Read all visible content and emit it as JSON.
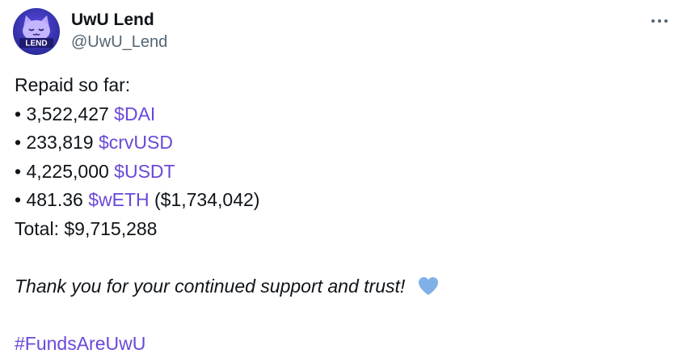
{
  "author": {
    "display_name": "UwU Lend",
    "handle": "@UwU_Lend",
    "avatar_label": "LEND"
  },
  "menu": {
    "icon": "more-horizontal-icon"
  },
  "tweet": {
    "intro": "Repaid so far:",
    "items": [
      {
        "bullet": "•",
        "amount": "3,522,427",
        "token": "$DAI",
        "extra": ""
      },
      {
        "bullet": "•",
        "amount": "233,819",
        "token": "$crvUSD",
        "extra": ""
      },
      {
        "bullet": "•",
        "amount": "4,225,000",
        "token": "$USDT",
        "extra": ""
      },
      {
        "bullet": "•",
        "amount": "481.36",
        "token": "$wETH",
        "extra": "($1,734,042)"
      }
    ],
    "total": "Total: $9,715,288",
    "thanks": "Thank you for your continued support and trust!",
    "heart_icon": "blue-heart-icon",
    "hashtag": "#FundsAreUwU"
  },
  "colors": {
    "link": "#6b48d9",
    "heart": "#7fb0e8",
    "text": "#0f1419",
    "secondary": "#536471"
  }
}
